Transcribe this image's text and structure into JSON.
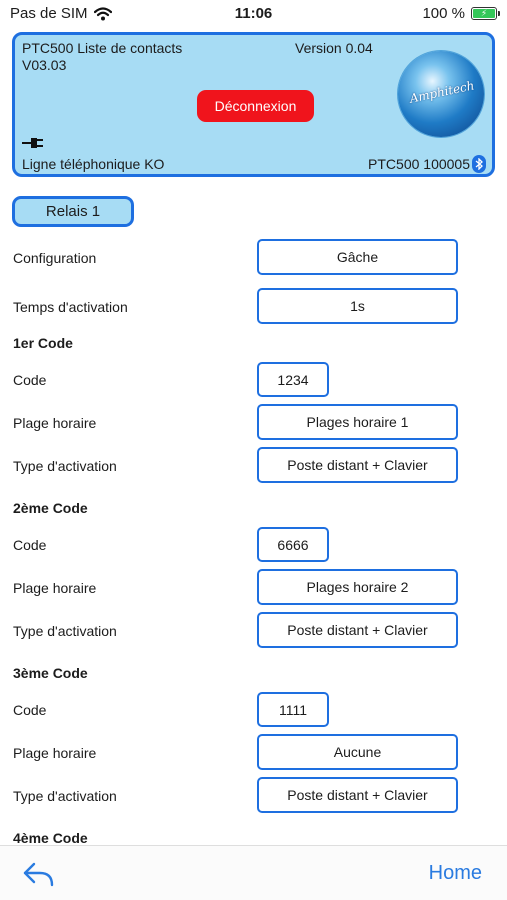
{
  "status_bar": {
    "carrier": "Pas de SIM",
    "time": "11:06",
    "battery": "100 %"
  },
  "header": {
    "title": "PTC500 Liste de contacts",
    "firmware": "V03.03",
    "app_version": "Version 0.04",
    "logout_label": "Déconnexion",
    "line_status": "Ligne téléphonique KO",
    "device": "PTC500 100005",
    "logo_text": "Amphitech"
  },
  "relay_tab": "Relais 1",
  "config": {
    "configuration_label": "Configuration",
    "configuration_value": "Gâche",
    "activation_time_label": "Temps d'activation",
    "activation_time_value": "1s"
  },
  "codes": [
    {
      "title": "1er Code",
      "code_label": "Code",
      "code_value": "1234",
      "schedule_label": "Plage horaire",
      "schedule_value": "Plages horaire 1",
      "activation_label": "Type d'activation",
      "activation_value": "Poste distant + Clavier"
    },
    {
      "title": "2ème Code",
      "code_label": "Code",
      "code_value": "6666",
      "schedule_label": "Plage horaire",
      "schedule_value": "Plages horaire 2",
      "activation_label": "Type d'activation",
      "activation_value": "Poste distant + Clavier"
    },
    {
      "title": "3ème Code",
      "code_label": "Code",
      "code_value": "1111",
      "schedule_label": "Plage horaire",
      "schedule_value": "Aucune",
      "activation_label": "Type d'activation",
      "activation_value": "Poste distant + Clavier"
    },
    {
      "title": "4ème Code"
    }
  ],
  "bottom_bar": {
    "home_label": "Home"
  },
  "icons": {
    "wifi": "wifi-icon",
    "battery": "battery-icon",
    "plug": "plug-icon",
    "bluetooth": "bluetooth-icon",
    "back": "back-arrow-icon"
  },
  "colors": {
    "accent": "#1e6fe0",
    "panel_bg": "#a7dcf4",
    "danger": "#f0141c",
    "link": "#2a7be0"
  }
}
